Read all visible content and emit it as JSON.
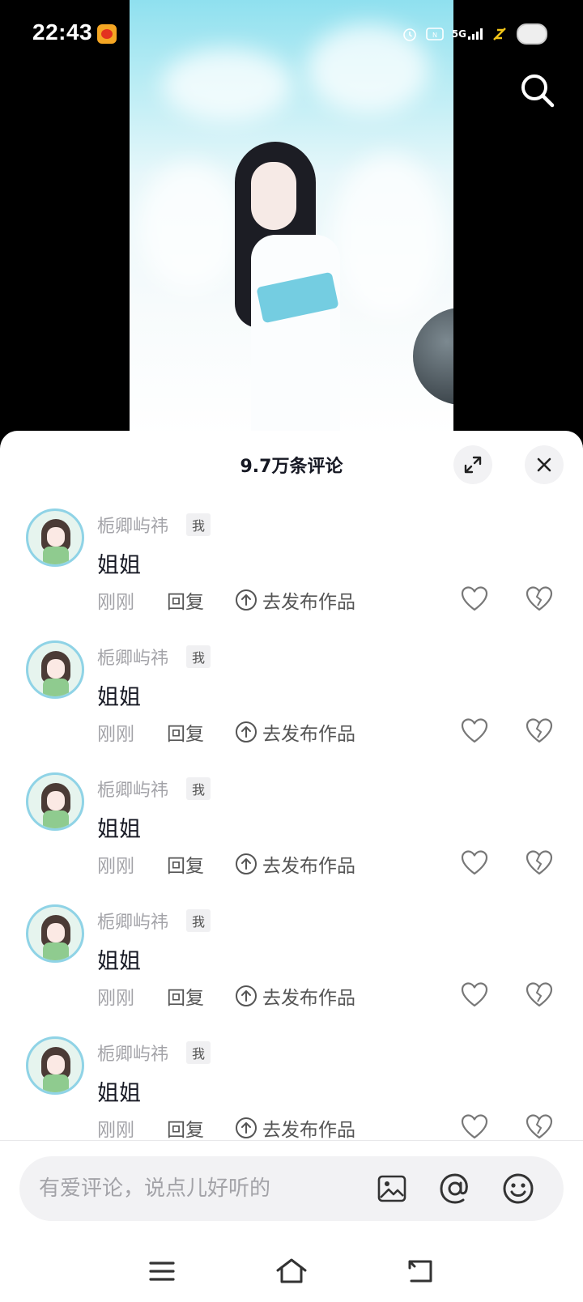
{
  "status_bar": {
    "time": "22:43",
    "network": "5G",
    "icons": [
      "weibo-notification-icon",
      "alarm-icon",
      "nfc-icon",
      "signal-icon",
      "charging-icon",
      "battery-icon"
    ]
  },
  "video": {
    "search_icon": "search-icon"
  },
  "comments_sheet": {
    "title": "9.7万条评论",
    "expand_icon": "expand-icon",
    "close_icon": "close-icon",
    "comments": [
      {
        "username": "栀卿屿祎",
        "tag": "我",
        "text": "姐姐",
        "time": "刚刚",
        "reply_label": "回复",
        "publish_label": "去发布作品"
      },
      {
        "username": "栀卿屿祎",
        "tag": "我",
        "text": "姐姐",
        "time": "刚刚",
        "reply_label": "回复",
        "publish_label": "去发布作品"
      },
      {
        "username": "栀卿屿祎",
        "tag": "我",
        "text": "姐姐",
        "time": "刚刚",
        "reply_label": "回复",
        "publish_label": "去发布作品"
      },
      {
        "username": "栀卿屿祎",
        "tag": "我",
        "text": "姐姐",
        "time": "刚刚",
        "reply_label": "回复",
        "publish_label": "去发布作品"
      },
      {
        "username": "栀卿屿祎",
        "tag": "我",
        "text": "姐姐",
        "time": "刚刚",
        "reply_label": "回复",
        "publish_label": "去发布作品"
      }
    ],
    "input": {
      "placeholder": "有爱评论，说点儿好听的",
      "value": ""
    }
  },
  "nav_bar": {
    "icons": [
      "menu-icon",
      "home-icon",
      "back-icon"
    ]
  },
  "colors": {
    "sheet_bg": "#ffffff",
    "muted_text": "#a3a3a8",
    "primary_text": "#161823"
  }
}
